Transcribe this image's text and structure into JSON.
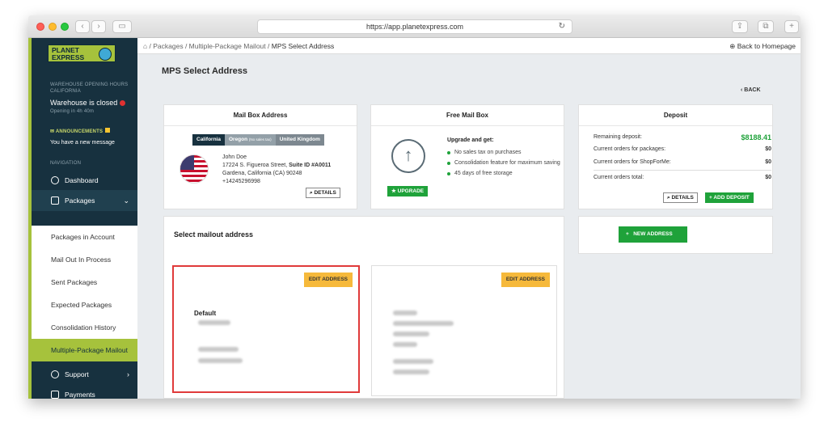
{
  "browser": {
    "url": "https://app.planetexpress.com"
  },
  "logo": {
    "line1": "PLANET",
    "line2": "EXPRESS"
  },
  "sidebar": {
    "warehouse_label": "WAREHOUSE OPENING HOURS",
    "warehouse_region": "CALIFORNIA",
    "warehouse_status": "Warehouse is closed",
    "opening_in": "Opening in 4h 40m",
    "announcements_label": "ANNOUNCEMENTS",
    "announcements_msg": "You have a new message",
    "navigation_label": "NAVIGATION",
    "dashboard": "Dashboard",
    "packages": "Packages",
    "sub_items": [
      "Packages in Account",
      "Mail Out In Process",
      "Sent Packages",
      "Expected Packages",
      "Consolidation History",
      "Multiple-Package Mailout"
    ],
    "support": "Support",
    "payments": "Payments"
  },
  "breadcrumb": {
    "parts": [
      "Packages",
      "Multiple-Package Mailout"
    ],
    "current": "MPS Select Address",
    "back_home": "Back to Homepage"
  },
  "page": {
    "title": "MPS Select Address",
    "back": "BACK"
  },
  "mailbox": {
    "title": "Mail Box Address",
    "tabs": [
      "California",
      "Oregon",
      "(No sales tax)",
      "United Kingdom"
    ],
    "name": "John Doe",
    "street": "17224 S. Figueroa Street,",
    "suite": "Suite ID #A0011",
    "city": "Gardena, California (CA) 90248",
    "phone": "+14245296998",
    "details": "DETAILS"
  },
  "free_mailbox": {
    "title": "Free Mail Box",
    "upgrade_title": "Upgrade and get:",
    "bullets": [
      "No sales tax on purchases",
      "Consolidation feature for maximum saving",
      "45 days of free storage"
    ],
    "upgrade_btn": "UPGRADE"
  },
  "deposit": {
    "title": "Deposit",
    "remaining_label": "Remaining deposit:",
    "remaining_value": "$8188.41",
    "packages_label": "Current orders for packages:",
    "packages_value": "$0",
    "shopforme_label": "Current orders for ShopForMe:",
    "shopforme_value": "$0",
    "total_label": "Current orders total:",
    "total_value": "$0",
    "details": "DETAILS",
    "add_deposit": "+ ADD DEPOSIT"
  },
  "mailout": {
    "title": "Select mailout address",
    "edit_label": "EDIT ADDRESS",
    "default_label": "Default",
    "new_address": "NEW ADDRESS"
  }
}
